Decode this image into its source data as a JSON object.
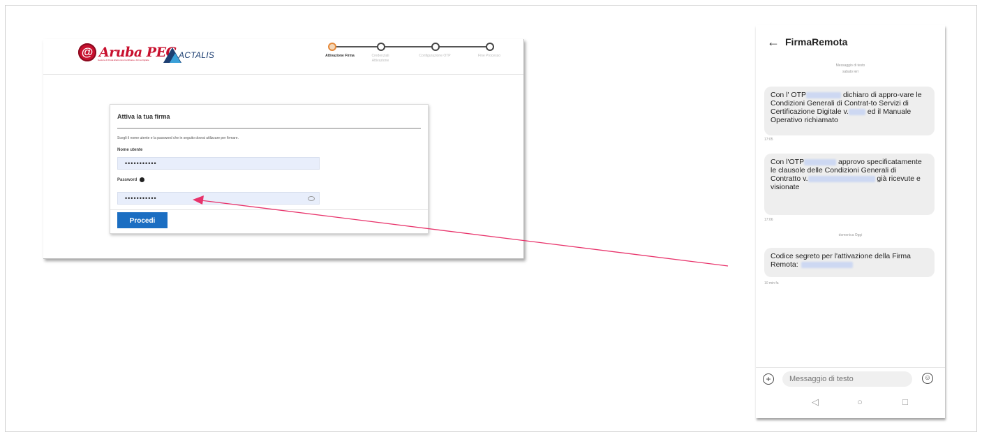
{
  "web": {
    "logo_aruba": "Aruba PEC",
    "logo_aruba_tagline": "Gestore di Posta Elettronica Certificata e Firma Digitale",
    "logo_actalis": "ACTALIS",
    "steps": [
      {
        "label": "Attivazione Firma",
        "active": true
      },
      {
        "label": "Credenziali Attivazione",
        "active": false
      },
      {
        "label": "Configurazione OTP",
        "active": false
      },
      {
        "label": "Fine Processo",
        "active": false
      }
    ],
    "card": {
      "title": "Attiva la tua firma",
      "description": "Scegli il nome utente e la password che in seguito dovrai utilizzare per firmare.",
      "username_label": "Nome utente",
      "username_value": "•••••••••••",
      "password_label": "Password",
      "password_value": "•••••••••••",
      "submit_label": "Procedi"
    }
  },
  "phone": {
    "back_icon": "arrow-left-icon",
    "title": "FirmaRemota",
    "header_meta_1": "Messaggio di testo",
    "header_meta_2": "sabato ieri",
    "messages": [
      {
        "p1": "Con l' OTP",
        "p2": " dichiaro di appro-vare le Condizioni Generali di Contrat-to Servizi di Certificazione Digitale v.",
        "p3": " ed il Manuale Operativo richiamato",
        "time": "17:05"
      },
      {
        "p1": "Con l'OTP",
        "p2": " approvo specificatamente le clausole delle Condizioni Generali di Contratto v.",
        "p3": " già ricevute e visionate",
        "time": "17:06"
      },
      {
        "p1": "Codice segreto per l'attivazione della Firma Remota:",
        "time": "10 min fa"
      }
    ],
    "day_separator": "domenica Oggi",
    "compose_placeholder": "Messaggio di testo",
    "nav_back": "◁",
    "nav_home": "○",
    "nav_recent": "□"
  },
  "colors": {
    "arrow": "#e8336b",
    "primary_button": "#1b6ec2",
    "aruba_red": "#c8102e",
    "actalis_blue": "#1d3f72",
    "step_active": "#e5893a"
  }
}
